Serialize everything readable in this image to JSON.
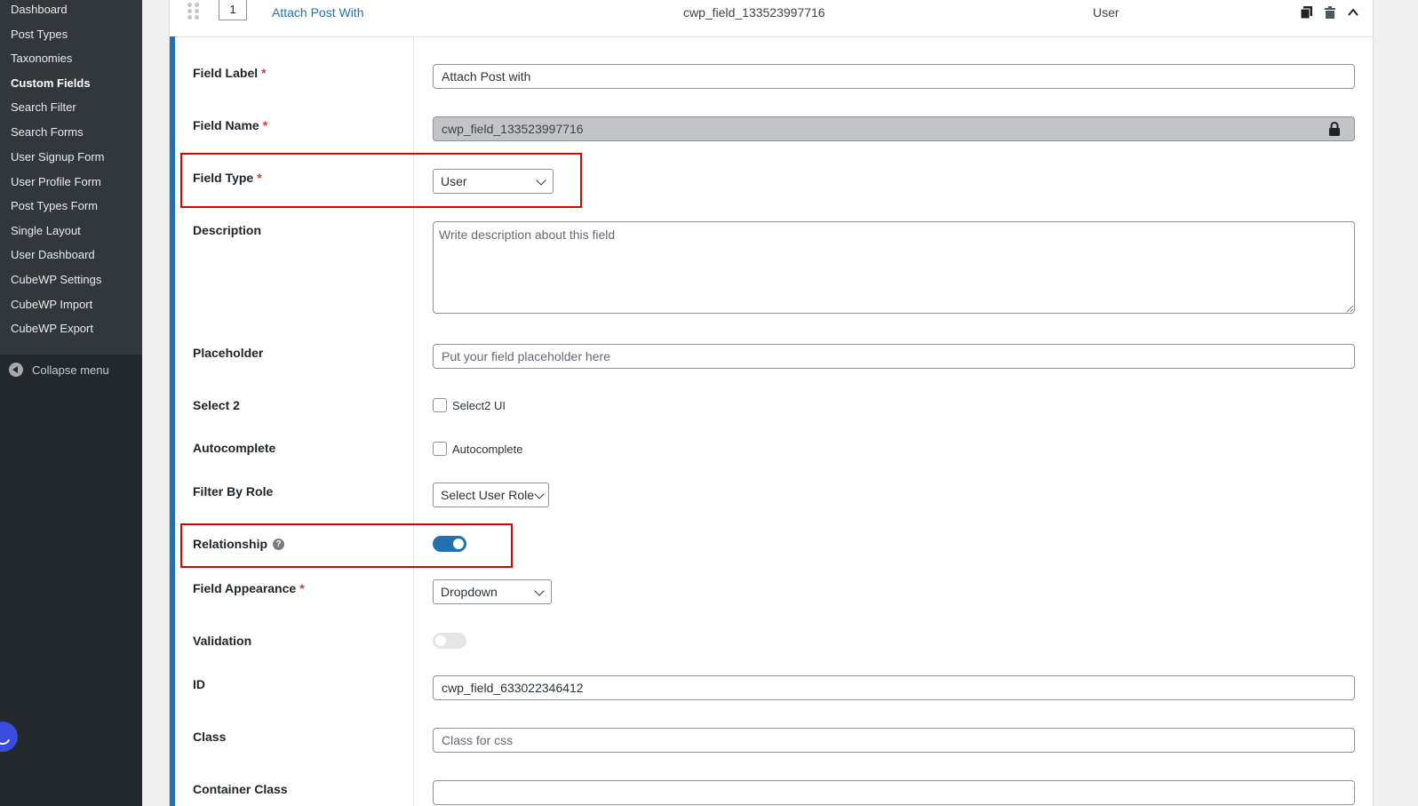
{
  "sidebar": {
    "items": [
      {
        "label": "Dashboard",
        "active": false
      },
      {
        "label": "Post Types",
        "active": false
      },
      {
        "label": "Taxonomies",
        "active": false
      },
      {
        "label": "Custom Fields",
        "active": true
      },
      {
        "label": "Search Filter",
        "active": false
      },
      {
        "label": "Search Forms",
        "active": false
      },
      {
        "label": "User Signup Form",
        "active": false
      },
      {
        "label": "User Profile Form",
        "active": false
      },
      {
        "label": "Post Types Form",
        "active": false
      },
      {
        "label": "Single Layout",
        "active": false
      },
      {
        "label": "User Dashboard",
        "active": false
      },
      {
        "label": "CubeWP Settings",
        "active": false
      },
      {
        "label": "CubeWP Import",
        "active": false
      },
      {
        "label": "CubeWP Export",
        "active": false
      }
    ],
    "collapse_label": "Collapse menu"
  },
  "field_header": {
    "order": "1",
    "title": "Attach Post With",
    "name": "cwp_field_133523997716",
    "type": "User"
  },
  "form": {
    "field_label": {
      "label": "Field Label",
      "value": "Attach Post with"
    },
    "field_name": {
      "label": "Field Name",
      "value": "cwp_field_133523997716"
    },
    "field_type": {
      "label": "Field Type",
      "value": "User"
    },
    "description": {
      "label": "Description",
      "placeholder": "Write description about this field"
    },
    "placeholder": {
      "label": "Placeholder",
      "placeholder": "Put your field placeholder here"
    },
    "select2": {
      "label": "Select 2",
      "checkbox_label": "Select2 UI",
      "checked": false
    },
    "autocomplete": {
      "label": "Autocomplete",
      "checkbox_label": "Autocomplete",
      "checked": false
    },
    "filter_by_role": {
      "label": "Filter By Role",
      "value": "Select User Role"
    },
    "relationship": {
      "label": "Relationship",
      "help": "?",
      "on": true
    },
    "field_appearance": {
      "label": "Field Appearance",
      "value": "Dropdown"
    },
    "validation": {
      "label": "Validation",
      "on": false
    },
    "id": {
      "label": "ID",
      "value": "cwp_field_633022346412"
    },
    "class": {
      "label": "Class",
      "placeholder": "Class for css"
    },
    "container_class": {
      "label": "Container Class"
    },
    "required_mark": "*"
  },
  "colors": {
    "accent": "#2271b1",
    "highlight": "#e00000",
    "required": "#d63638",
    "sidebar_bg": "#23282d"
  }
}
